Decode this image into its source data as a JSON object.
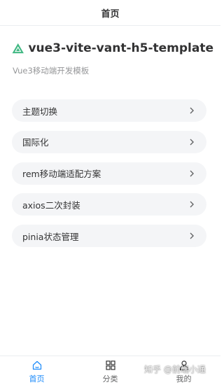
{
  "navbar": {
    "title": "首页"
  },
  "hero": {
    "title": "vue3-vite-vant-h5-template",
    "subtitle": "Vue3移动端开发模板",
    "logo_icon": "vite-triangle-logo",
    "logo_color": "#41b883"
  },
  "menu": {
    "items": [
      {
        "label": "主题切换"
      },
      {
        "label": "国际化"
      },
      {
        "label": "rem移动端适配方案"
      },
      {
        "label": "axios二次封装"
      },
      {
        "label": "pinia状态管理"
      }
    ],
    "chevron_icon": "chevron-right-icon"
  },
  "tabbar": {
    "active_color": "#1989fa",
    "tabs": [
      {
        "label": "首页",
        "icon": "home-icon",
        "active": true
      },
      {
        "label": "分类",
        "icon": "grid-icon",
        "active": false
      },
      {
        "label": "我的",
        "icon": "user-icon",
        "active": false
      }
    ]
  },
  "watermark": {
    "text": "知乎 @前端小通"
  }
}
